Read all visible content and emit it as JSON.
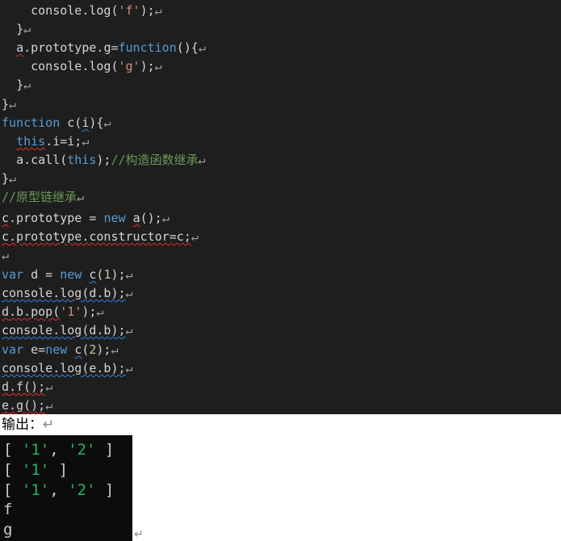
{
  "code": {
    "l1": {
      "fn": "console",
      "dot": ".",
      "m": "log",
      "p1": "(",
      "s": "'f'",
      "p2": ");"
    },
    "l2": "}",
    "l3": {
      "obj": "a",
      "dot": ".",
      "proto": "prototype",
      "dot2": ".",
      "g": "g",
      "eq": "=",
      "kw": "function",
      "rest": "(){"
    },
    "l4": {
      "fn": "console",
      "dot": ".",
      "m": "log",
      "p1": "(",
      "s": "'g'",
      "p2": ");"
    },
    "l5": "}",
    "l6": "}",
    "l7": {
      "kw": "function",
      "name": " c(",
      "arg": "i",
      "rest": "){"
    },
    "l8": {
      "kw": "this",
      "rest": ".i=i;"
    },
    "l9": {
      "a": "a.call(",
      "kw": "this",
      "rest": ");",
      "cm": "//构造函数继承"
    },
    "l10": "}",
    "l11": "//原型链继承",
    "l12": {
      "c": "c",
      "rest": ".prototype = ",
      "kw": "new",
      "sp": " ",
      "a": "a",
      "end": "();"
    },
    "l13": {
      "c": "c",
      "rest": ".prototype.constructor=c;"
    },
    "l14": "",
    "l15": {
      "kw": "var",
      "rest": " d = ",
      "kw2": "new",
      "sp": " ",
      "c": "c",
      "p": "(",
      "n": "1",
      "e": ");"
    },
    "l16": {
      "c": "console",
      "rest": ".log(d.b);"
    },
    "l17": {
      "d": "d",
      "rest": ".b.pop(",
      "s": "'1'",
      "e": ");"
    },
    "l18": {
      "c": "console",
      "rest": ".log(d.b);"
    },
    "l19": {
      "kw": "var",
      "rest": " e=",
      "kw2": "new",
      "sp": " ",
      "c": "c",
      "p": "(",
      "n": "2",
      "e": ");"
    },
    "l20": {
      "c": "console",
      "rest": ".log(e.b);"
    },
    "l21": {
      "d": "d",
      "rest": ".f();"
    },
    "l22": {
      "e": "e",
      "rest": ".g();"
    }
  },
  "paragraph_mark": "↵",
  "output_label": "输出：",
  "console": {
    "lines": [
      {
        "open": "[ ",
        "a": "'1'",
        "sep": ", ",
        "b": "'2'",
        "close": " ]"
      },
      {
        "open": "[ ",
        "a": "'1'",
        "close": " ]"
      },
      {
        "open": "[ ",
        "a": "'1'",
        "sep": ", ",
        "b": "'2'",
        "close": " ]"
      }
    ],
    "f": "f",
    "g": "g"
  },
  "colors": {
    "editor_bg": "#1e1e1e",
    "keyword": "#569cd6",
    "string": "#ce9178",
    "comment": "#6a9955",
    "console_bg": "#0c0c0c",
    "console_string": "#19b86a"
  }
}
